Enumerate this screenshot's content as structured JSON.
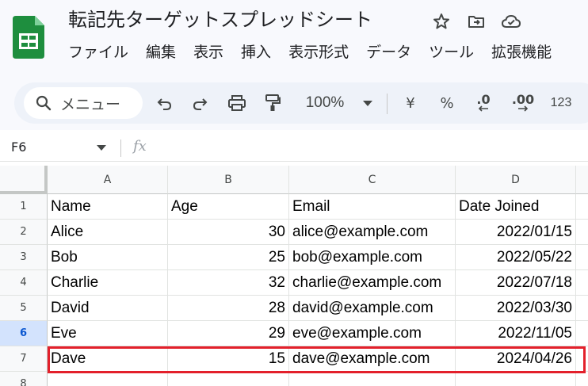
{
  "document": {
    "title": "転記先ターゲットスプレッドシート"
  },
  "menu": [
    "ファイル",
    "編集",
    "表示",
    "挿入",
    "表示形式",
    "データ",
    "ツール",
    "拡張機能"
  ],
  "toolbar": {
    "search_label": "メニュー",
    "zoom": "100%",
    "currency": "¥",
    "percent": "%",
    "decrease_decimal": ".0",
    "increase_decimal": ".00",
    "more_formats": "123"
  },
  "formula_bar": {
    "cell_ref": "F6",
    "fx": "fx"
  },
  "sheet": {
    "columns": [
      "A",
      "B",
      "C",
      "D"
    ],
    "row_numbers": [
      "1",
      "2",
      "3",
      "4",
      "5",
      "6",
      "7",
      "8"
    ],
    "active_row": "6",
    "highlighted_row": "7",
    "rows": [
      [
        "Name",
        "Age",
        "Email",
        "Date Joined"
      ],
      [
        "Alice",
        "30",
        "alice@example.com",
        "2022/01/15"
      ],
      [
        "Bob",
        "25",
        "bob@example.com",
        "2022/05/22"
      ],
      [
        "Charlie",
        "32",
        "charlie@example.com",
        "2022/07/18"
      ],
      [
        "David",
        "28",
        "david@example.com",
        "2022/03/30"
      ],
      [
        "Eve",
        "29",
        "eve@example.com",
        "2022/11/05"
      ],
      [
        "Dave",
        "15",
        "dave@example.com",
        "2024/04/26"
      ],
      [
        "",
        "",
        "",
        ""
      ]
    ]
  },
  "colors": {
    "accent": "#0b57d0",
    "sheets_green": "#1e8e3e",
    "highlight_red": "#e3202b"
  }
}
